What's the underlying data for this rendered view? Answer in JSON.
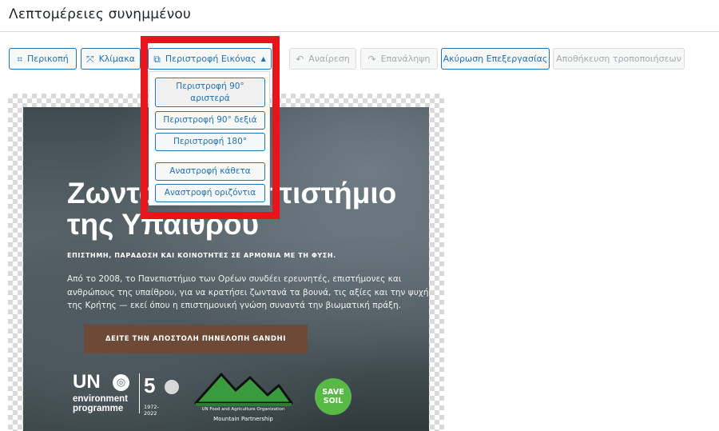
{
  "header": {
    "title": "Λεπτομέρειες συνημμένου"
  },
  "toolbar": {
    "crop": {
      "label": "Περικοπή",
      "icon": "crop-icon"
    },
    "scale": {
      "label": "Κλίμακα",
      "icon": "scale-icon"
    },
    "rotate": {
      "label": "Περιστροφή Εικόνας",
      "icon": "rotate-icon"
    },
    "undo": {
      "label": "Αναίρεση",
      "icon": "undo-icon"
    },
    "redo": {
      "label": "Επανάληψη",
      "icon": "redo-icon"
    },
    "cancel": {
      "label": "Ακύρωση Επεξεργασίας"
    },
    "save": {
      "label": "Αποθήκευση τροποποιήσεων"
    }
  },
  "rotate_menu": {
    "items": [
      {
        "label": "Περιστροφή 90° αριστερά"
      },
      {
        "label": "Περιστροφή 90° δεξιά"
      },
      {
        "label": "Περιστροφή 180°"
      },
      {
        "label": "Αναστροφή κάθετα"
      },
      {
        "label": "Αναστροφή οριζόντια"
      }
    ]
  },
  "image": {
    "heading": "Ζωντανό Πανεπιστήμιο της Υπαίθρου",
    "subhead": "ΕΠΙΣΤΗΜΗ, ΠΑΡΑΔΟΣΗ ΚΑΙ ΚΟΙΝΟΤΗΤΕΣ ΣΕ ΑΡΜΟΝΙΑ ΜΕ ΤΗ ΦΥΣΗ.",
    "paragraph": "Από το 2008, το Πανεπιστήμιο των Ορέων συνδέει ερευνητές, επιστήμονες και ανθρώπους της υπαίθρου, για να κρατήσει ζωντανά τα βουνά, τις αξίες και την ψυχή της Κρήτης — εκεί όπου η επιστημονική γνώση συναντά την βιωματική πράξη.",
    "cta": "ΔΕΙΤΕ ΤΗΝ ΑΠΟΣΤΟΛΗ ΠΗΝΕΛΟΠΗ GANDHI",
    "logos": {
      "unep_un": "UN",
      "unep_name": "environment programme",
      "unep_50": "5",
      "unep_years": "1972-2022",
      "mp_org": "UN Food and Agriculture Organization",
      "mp_name": "Mountain Partnership",
      "save_soil_1": "SAVE",
      "save_soil_2": "SOIL"
    }
  },
  "colors": {
    "accent": "#2271b1",
    "highlight": "#e8141c",
    "cta_bg": "#6c4a37",
    "save_soil": "#58b947"
  }
}
